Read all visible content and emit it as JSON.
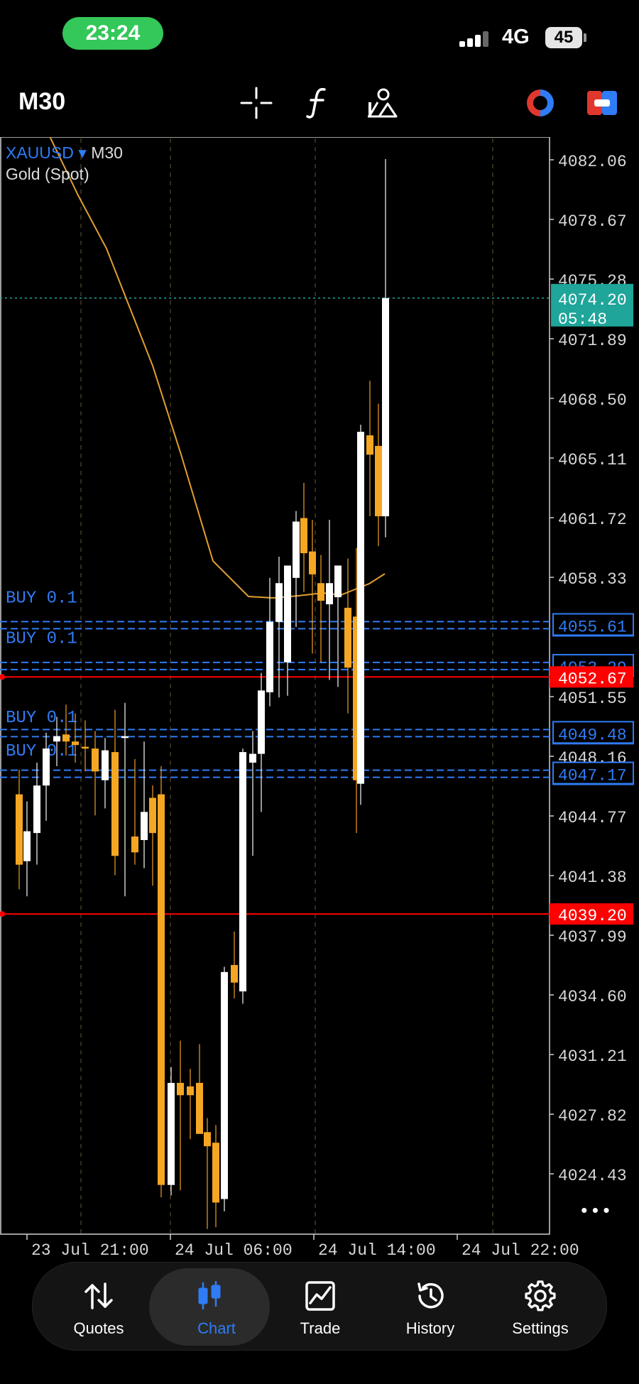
{
  "status_bar": {
    "time": "23:24",
    "network": "4G",
    "battery": "45"
  },
  "toolbar": {
    "timeframe": "M30",
    "icons": [
      "crosshair-icon",
      "indicators-icon",
      "objects-icon",
      "one-click-trading-icon",
      "new-order-icon"
    ]
  },
  "chart": {
    "symbol": "XAUUSD",
    "timeframe": "M30",
    "description": "Gold (Spot)",
    "price_labels": [
      "4082.06",
      "4078.67",
      "4075.28",
      "4071.89",
      "4068.50",
      "4065.11",
      "4061.72",
      "4058.33",
      "4051.55",
      "4048.16",
      "4044.77",
      "4041.38",
      "4037.99",
      "4034.60",
      "4031.21",
      "4027.82",
      "4024.43"
    ],
    "current_price": "4074.20",
    "current_timer": "05:48",
    "red_levels": [
      "4052.67",
      "4039.20"
    ],
    "order_levels": [
      "4055.61",
      "4053.29",
      "4049.48",
      "4047.17"
    ],
    "order_labels": [
      "BUY 0.1",
      "BUY 0.1",
      "BUY 0.1",
      "BUY 0.1"
    ],
    "time_labels": [
      "23 Jul 21:00",
      "24 Jul 06:00",
      "24 Jul 14:00",
      "24 Jul 22:00"
    ],
    "more_menu": "•••",
    "colors": {
      "bull": "#ffffff",
      "bear": "#f5a623",
      "ma": "#e0a030",
      "order": "#2f7cf6",
      "level": "#ff0000",
      "bid": "#1fa59a"
    }
  },
  "bottom_nav": {
    "items": [
      {
        "label": "Quotes",
        "icon": "quotes-icon"
      },
      {
        "label": "Chart",
        "icon": "chart-candles-icon",
        "active": true
      },
      {
        "label": "Trade",
        "icon": "trade-icon"
      },
      {
        "label": "History",
        "icon": "history-icon"
      },
      {
        "label": "Settings",
        "icon": "settings-icon"
      }
    ]
  }
}
